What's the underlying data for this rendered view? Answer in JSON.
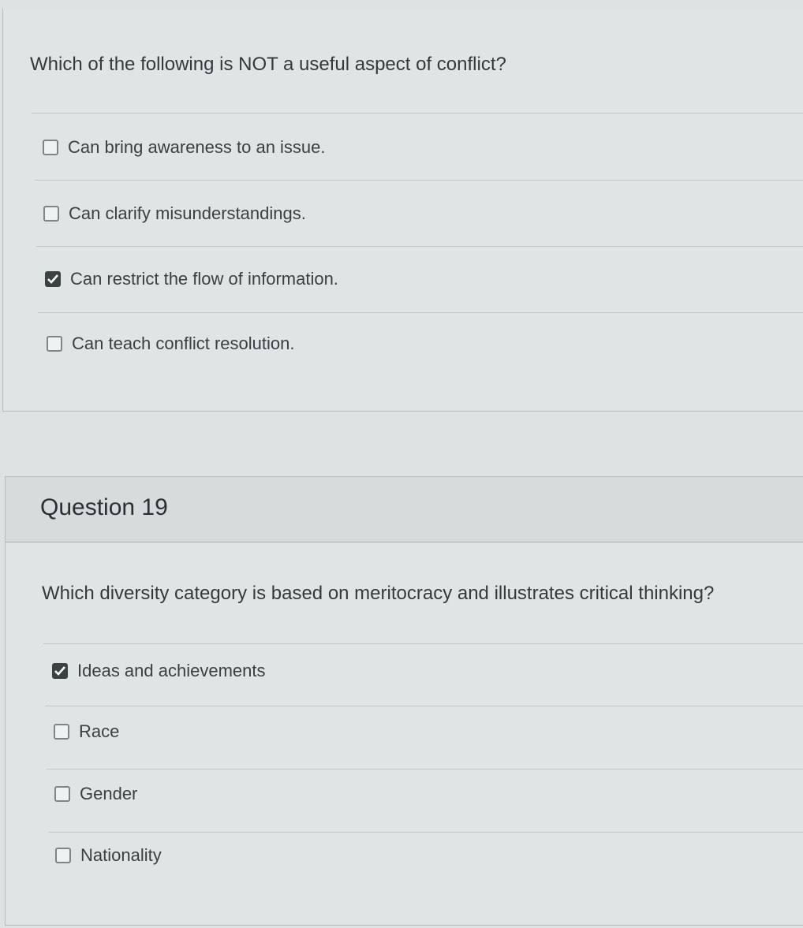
{
  "question_18": {
    "prompt": "Which of the following is NOT a useful aspect of conflict?",
    "answers": [
      {
        "label": "Can bring awareness to an issue.",
        "checked": false
      },
      {
        "label": "Can clarify misunderstandings.",
        "checked": false
      },
      {
        "label": "Can restrict the flow of information.",
        "checked": true
      },
      {
        "label": "Can teach conflict resolution.",
        "checked": false
      }
    ]
  },
  "question_19": {
    "title": "Question 19",
    "prompt": "Which diversity category is based on meritocracy and illustrates critical thinking?",
    "answers": [
      {
        "label": "Ideas and achievements",
        "checked": true
      },
      {
        "label": "Race",
        "checked": false
      },
      {
        "label": "Gender",
        "checked": false
      },
      {
        "label": "Nationality",
        "checked": false
      }
    ]
  }
}
